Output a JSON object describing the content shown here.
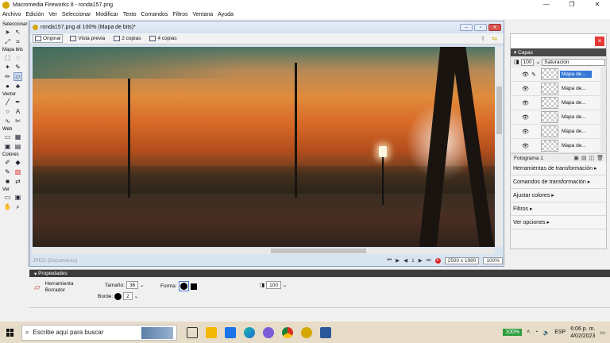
{
  "window": {
    "title": "Macromedia Fireworks 8 - ronda157.png",
    "controls": [
      "—",
      "❐",
      "✕"
    ]
  },
  "menu": [
    "Archivo",
    "Edición",
    "Ver",
    "Seleccionar",
    "Modificar",
    "Texto",
    "Comandos",
    "Filtros",
    "Ventana",
    "Ayuda"
  ],
  "tools": {
    "sections": [
      "Seleccionar",
      "Mapa bits",
      "Vector",
      "Web",
      "Colores",
      "Ver"
    ]
  },
  "document": {
    "title": "ronda157.png al 100% (Mapa de bits)*",
    "tabs": [
      "Original",
      "Vista previa",
      "2 copias",
      "4 copias"
    ],
    "status_left": "JPEG (Documento)",
    "page_number": "1",
    "size": "2500 x 1980",
    "zoom": "100%"
  },
  "layers_panel": {
    "title": "Capas",
    "opacity": "100",
    "blend_mode": "Saturación",
    "layers": [
      "Mapa de...",
      "Mapa de...",
      "Mapa de...",
      "Mapa de...",
      "Mapa de...",
      "Mapa de..."
    ],
    "frame": "Fotograma 1",
    "links": [
      "Herramientas de transformación",
      "Comandos de transformación",
      "Ajustar colores",
      "Filtros",
      "Ver opciones"
    ]
  },
  "properties": {
    "title": "Propiedades",
    "tool_name_1": "Herramienta",
    "tool_name_2": "Borrador",
    "size_label": "Tamaño:",
    "size_value": "36",
    "shape_label": "Forma:",
    "edge_label": "Borde:",
    "edge_value": "2",
    "opacity_value": "100"
  },
  "taskbar": {
    "search_placeholder": "Escribe aquí para buscar",
    "battery": "100%",
    "lang": "ESP",
    "time": "6:06 p. m.",
    "date": "4/02/2023"
  }
}
